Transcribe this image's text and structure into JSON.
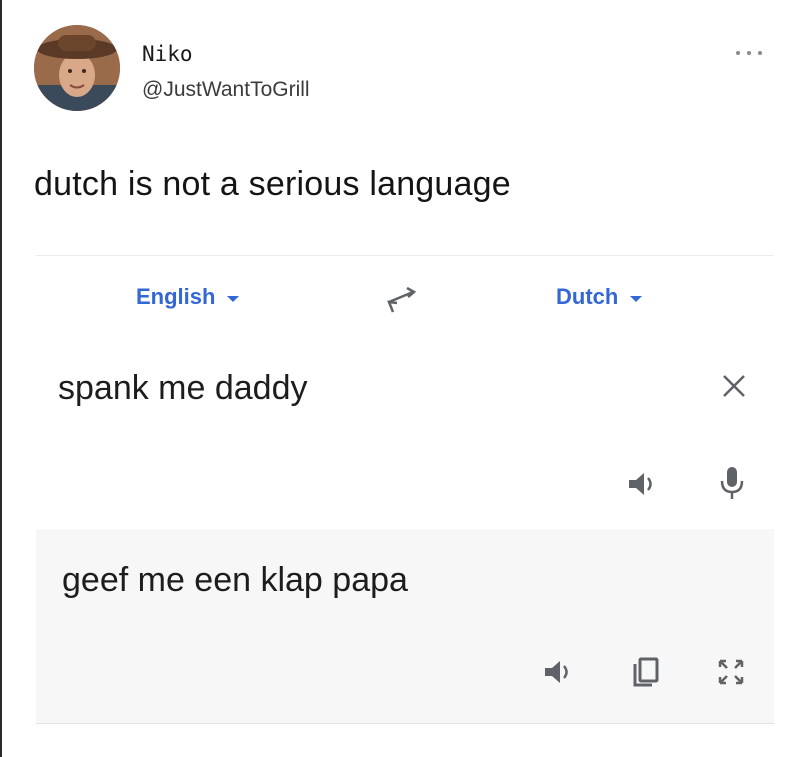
{
  "tweet": {
    "display_name": "Niko",
    "handle": "@JustWantToGrill",
    "text": "dutch is not a serious language"
  },
  "translate": {
    "source_language": "English",
    "target_language": "Dutch",
    "source_text": "spank me daddy",
    "translated_text": "geef me een klap papa"
  },
  "icons": {
    "more": "more-horizontal-icon",
    "swap": "swap-languages-icon",
    "clear": "close-icon",
    "speaker": "speaker-icon",
    "mic": "microphone-icon",
    "copy": "copy-icon",
    "expand": "fullscreen-icon"
  },
  "colors": {
    "accent": "#3367d6",
    "icon_gray": "#5f6368",
    "target_bg": "#f7f7f7"
  }
}
